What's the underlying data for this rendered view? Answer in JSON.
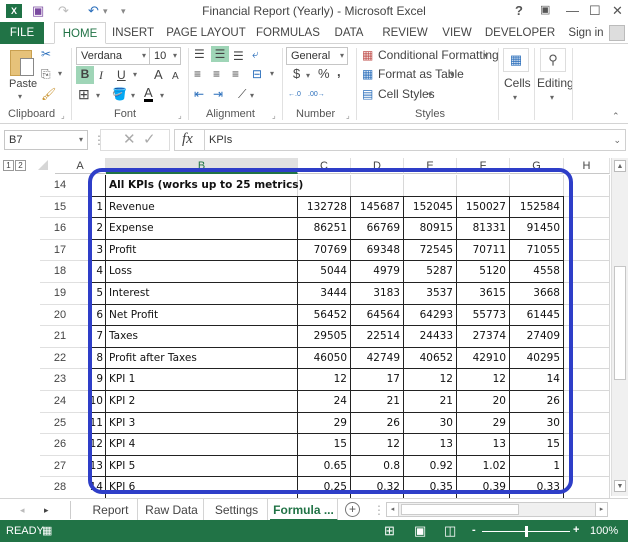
{
  "window": {
    "title": "Financial Report (Yearly) - Microsoft Excel",
    "help": "?",
    "restore_ribbon": "▣",
    "minimize": "—",
    "maximize": "☐",
    "close": "✕"
  },
  "qat": {
    "app_icon": "X",
    "save": "💾",
    "redo": "↷",
    "undo": "↶",
    "customize": "▾"
  },
  "tabs": {
    "file": "FILE",
    "items": [
      "HOME",
      "INSERT",
      "PAGE LAYOUT",
      "FORMULAS",
      "DATA",
      "REVIEW",
      "VIEW",
      "DEVELOPER"
    ],
    "active": "HOME",
    "sign_in": "Sign in"
  },
  "ribbon": {
    "clipboard": {
      "label": "Clipboard",
      "paste": "Paste"
    },
    "font": {
      "label": "Font",
      "name": "Verdana",
      "size": "10",
      "bold": "B",
      "italic": "I",
      "underline": "U",
      "grow": "A",
      "shrink": "A",
      "font_color": "A"
    },
    "alignment": {
      "label": "Alignment"
    },
    "number": {
      "label": "Number",
      "format": "General",
      "currency": "$",
      "percent": "%",
      "comma": ",",
      "inc_decimal": "←.0 .00",
      "dec_decimal": ".00 →.0"
    },
    "styles": {
      "label": "Styles",
      "conditional": "Conditional Formatting",
      "format_table": "Format as Table",
      "cell_styles": "Cell Styles"
    },
    "cells": {
      "label": "Cells"
    },
    "editing": {
      "label": "Editing"
    }
  },
  "formula_bar": {
    "name_box": "B7",
    "cancel": "✕",
    "enter": "✓",
    "fx": "fx",
    "value": "KPIs"
  },
  "outline_levels": [
    "1",
    "2"
  ],
  "columns": [
    "A",
    "B",
    "C",
    "D",
    "E",
    "F",
    "G",
    "H"
  ],
  "selected_column": "B",
  "rows": [
    "14",
    "15",
    "16",
    "17",
    "18",
    "19",
    "20",
    "21",
    "22",
    "23",
    "24",
    "25",
    "26",
    "27",
    "28"
  ],
  "table": {
    "header": "All KPIs (works up to 25 metrics)",
    "metrics": [
      {
        "n": "1",
        "name": "Revenue",
        "values": [
          "132728",
          "145687",
          "152045",
          "150027",
          "152584"
        ]
      },
      {
        "n": "2",
        "name": "Expense",
        "values": [
          "86251",
          "66769",
          "80915",
          "81331",
          "91450"
        ]
      },
      {
        "n": "3",
        "name": "Profit",
        "values": [
          "70769",
          "69348",
          "72545",
          "70711",
          "71055"
        ]
      },
      {
        "n": "4",
        "name": "Loss",
        "values": [
          "5044",
          "4979",
          "5287",
          "5120",
          "4558"
        ]
      },
      {
        "n": "5",
        "name": "Interest",
        "values": [
          "3444",
          "3183",
          "3537",
          "3615",
          "3668"
        ]
      },
      {
        "n": "6",
        "name": "Net Profit",
        "values": [
          "56452",
          "64564",
          "64293",
          "55773",
          "61445"
        ]
      },
      {
        "n": "7",
        "name": "Taxes",
        "values": [
          "29505",
          "22514",
          "24433",
          "27374",
          "27409"
        ]
      },
      {
        "n": "8",
        "name": "Profit after Taxes",
        "values": [
          "46050",
          "42749",
          "40652",
          "42910",
          "40295"
        ]
      },
      {
        "n": "9",
        "name": "KPI 1",
        "values": [
          "12",
          "17",
          "12",
          "12",
          "14"
        ]
      },
      {
        "n": "10",
        "name": "KPI 2",
        "values": [
          "24",
          "21",
          "21",
          "20",
          "26"
        ]
      },
      {
        "n": "11",
        "name": "KPI 3",
        "values": [
          "29",
          "26",
          "30",
          "29",
          "30"
        ]
      },
      {
        "n": "12",
        "name": "KPI 4",
        "values": [
          "15",
          "12",
          "13",
          "13",
          "15"
        ]
      },
      {
        "n": "13",
        "name": "KPI 5",
        "values": [
          "0.65",
          "0.8",
          "0.92",
          "1.02",
          "1"
        ]
      },
      {
        "n": "14",
        "name": "KPI 6",
        "values": [
          "0.25",
          "0.32",
          "0.35",
          "0.39",
          "0.33"
        ]
      }
    ]
  },
  "sheet_tabs": [
    "Report",
    "Raw Data",
    "Settings",
    "Formula ..."
  ],
  "active_sheet": "Formula ...",
  "status": {
    "ready": "READY",
    "zoom": "100%",
    "zoom_out": "-",
    "zoom_in": "+"
  },
  "colors": {
    "excel_green": "#217346",
    "highlight_frame": "#2e3ec8"
  }
}
